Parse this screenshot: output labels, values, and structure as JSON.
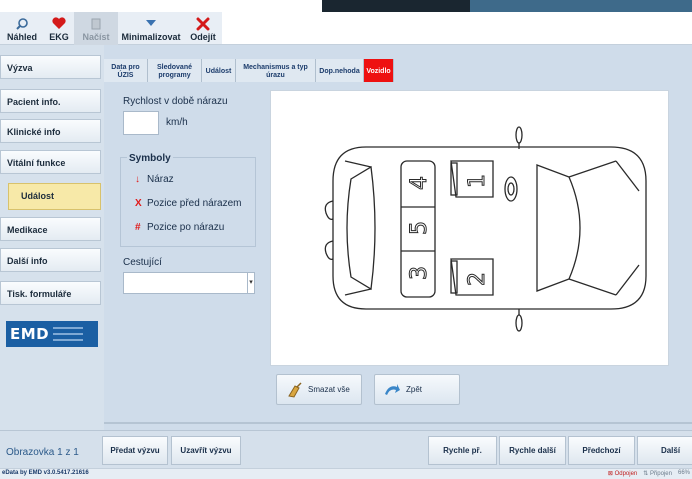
{
  "toolbar": {
    "nahled": "Náhled",
    "ekg": "EKG",
    "nacist": "Načíst",
    "minimalizovat": "Minimalizovat",
    "odejit": "Odejít"
  },
  "sidebar": {
    "items": [
      {
        "label": "Výzva"
      },
      {
        "label": "Pacient info."
      },
      {
        "label": "Klinické info"
      },
      {
        "label": "Vitální funkce"
      },
      {
        "label": "Událost"
      },
      {
        "label": "Medikace"
      },
      {
        "label": "Další info"
      },
      {
        "label": "Tisk. formuláře"
      }
    ],
    "logo_text": "EMD"
  },
  "tabs": [
    {
      "label": "Data pro ÚZIS"
    },
    {
      "label": "Sledované programy"
    },
    {
      "label": "Událost"
    },
    {
      "label": "Mechanismus a typ úrazu"
    },
    {
      "label": "Dop.nehoda"
    },
    {
      "label": "Vozidlo"
    }
  ],
  "form": {
    "speed_label": "Rychlost v době nárazu",
    "speed_value": "",
    "speed_unit": "km/h",
    "symbols_title": "Symboly",
    "symbols": [
      {
        "mark": "↓",
        "label": "Náraz"
      },
      {
        "mark": "X",
        "label": "Pozice před nárazem"
      },
      {
        "mark": "#",
        "label": "Pozice po nárazu"
      }
    ],
    "passenger_label": "Cestující",
    "passenger_value": ""
  },
  "diagram": {
    "seat_labels": [
      "1",
      "2",
      "3",
      "4",
      "5"
    ]
  },
  "actions": {
    "clear_all": "Smazat vše",
    "back": "Zpět"
  },
  "bottom": {
    "screen_label": "Obrazovka 1 z 1",
    "predat": "Předat výzvu",
    "uzavrit": "Uzavřít výzvu",
    "rychle": "Rychle př.",
    "rychle_dalsi": "Rychle další",
    "predchozi": "Předchozí",
    "dalsi": "Další"
  },
  "status": {
    "version": "eData by EMD v3.0.5417.21616",
    "disconnect": "Odpojen",
    "connect": "Připojen",
    "zoom": "66%"
  },
  "colors": {
    "accent_red": "#ee1111",
    "active_side": "#f7e9a8",
    "brand_blue": "#1b5fa3"
  }
}
